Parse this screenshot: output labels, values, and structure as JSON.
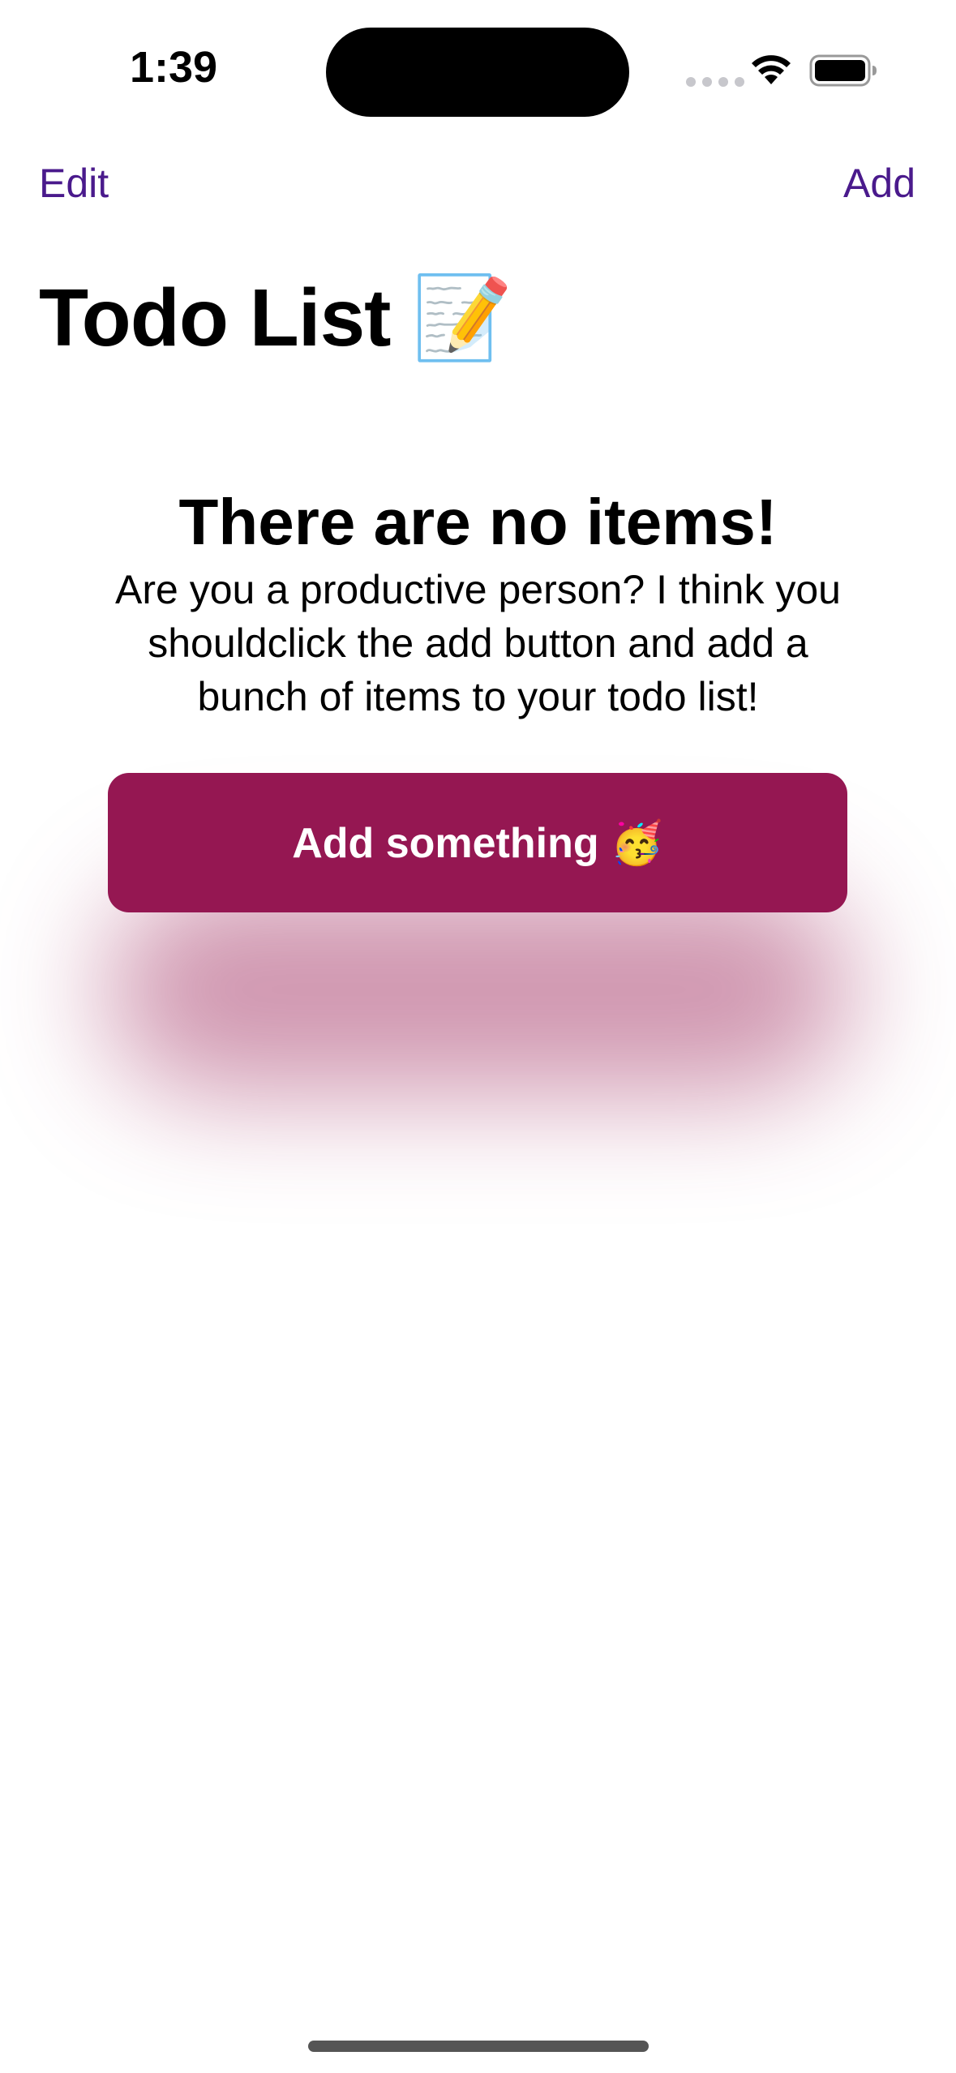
{
  "status_bar": {
    "time": "1:39"
  },
  "nav": {
    "edit_label": "Edit",
    "add_label": "Add"
  },
  "page": {
    "title": "Todo List 📝"
  },
  "empty_state": {
    "title": "There are no items!",
    "message": "Are you a productive person? I think you shouldclick the add button and add a bunch of items to your todo list!",
    "button_label": "Add something 🥳"
  },
  "colors": {
    "accent": "#4a1a8c",
    "button": "#951752"
  },
  "icons": [
    "cellular-signal-icon",
    "wifi-icon",
    "battery-icon"
  ]
}
